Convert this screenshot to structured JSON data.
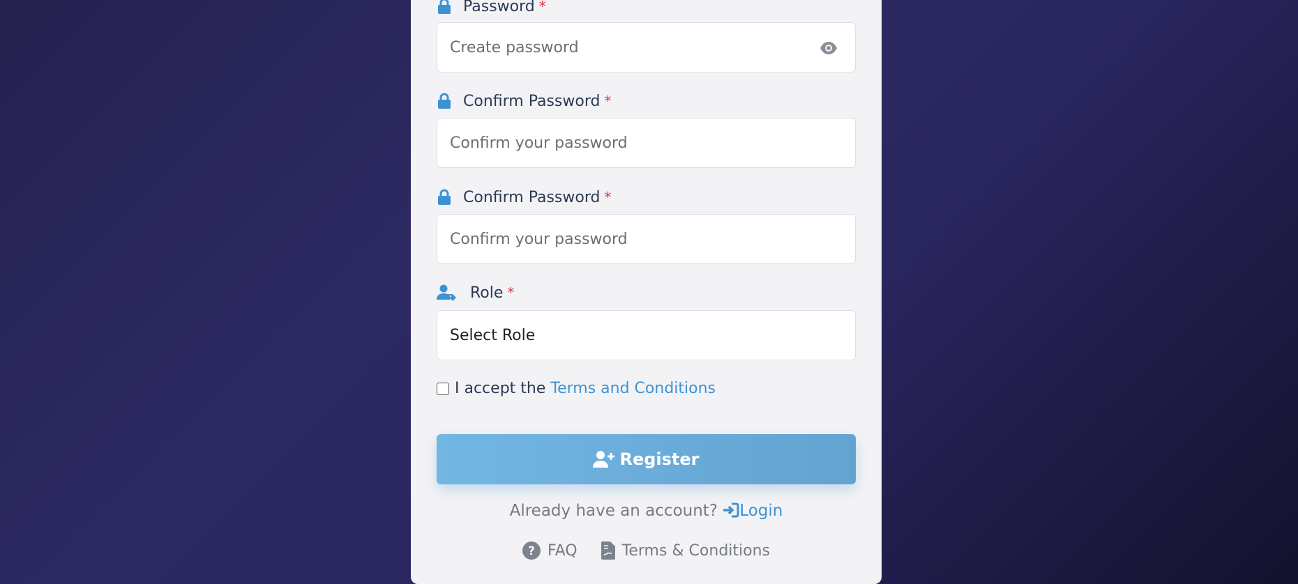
{
  "fields": [
    {
      "label": "Password",
      "required_mark": "*",
      "placeholder": "Create password"
    },
    {
      "label": "Confirm Password",
      "required_mark": "*",
      "placeholder": "Confirm your password"
    },
    {
      "label": "Confirm Password",
      "required_mark": "*",
      "placeholder": "Confirm your password"
    }
  ],
  "role": {
    "label": "Role",
    "required_mark": "*",
    "selected": "Select Role"
  },
  "terms": {
    "prefix": "I accept the",
    "link": "Terms and Conditions",
    "checked": false
  },
  "register_button": {
    "label": "Register"
  },
  "login_prompt": {
    "text": "Already have an account?",
    "link": "Login"
  },
  "footer": {
    "faq": "FAQ",
    "terms": "Terms & Conditions"
  },
  "colors": {
    "accent": "#3b93d6",
    "required": "#e0344b",
    "button": "#6aaedb"
  }
}
